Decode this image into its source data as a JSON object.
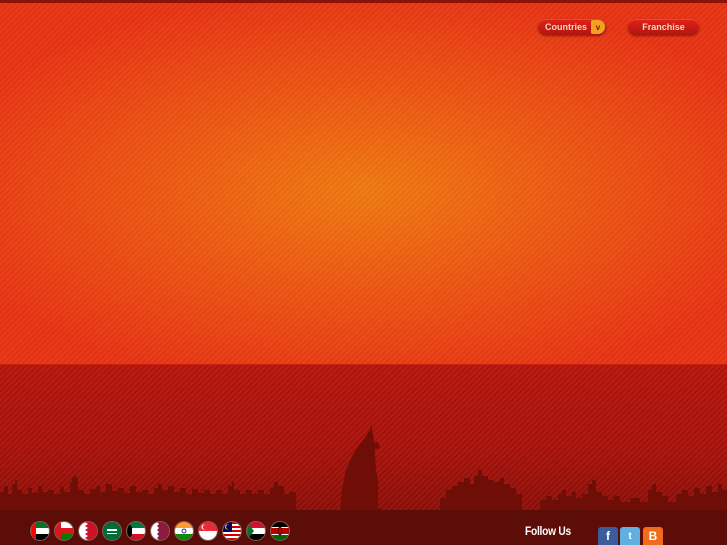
{
  "header": {
    "countries_label": "Countries",
    "countries_arrow": "v",
    "franchise_label": "Franchise"
  },
  "footer": {
    "follow_label": "Follow Us",
    "flags": [
      {
        "name": "uae",
        "colors": [
          "#00732f",
          "#ffffff",
          "#000000",
          "#ff0000"
        ]
      },
      {
        "name": "oman",
        "colors": [
          "#ffffff",
          "#db161b",
          "#008000"
        ]
      },
      {
        "name": "bahrain",
        "colors": [
          "#ce1126",
          "#ffffff"
        ]
      },
      {
        "name": "saudi-arabia",
        "colors": [
          "#006c35",
          "#ffffff"
        ]
      },
      {
        "name": "kuwait",
        "colors": [
          "#007a3d",
          "#ffffff",
          "#ce1126",
          "#000000"
        ]
      },
      {
        "name": "qatar",
        "colors": [
          "#8d1b3d",
          "#ffffff"
        ]
      },
      {
        "name": "india",
        "colors": [
          "#ff9933",
          "#ffffff",
          "#138808"
        ]
      },
      {
        "name": "singapore",
        "colors": [
          "#ed2939",
          "#ffffff"
        ]
      },
      {
        "name": "malaysia",
        "colors": [
          "#cc0001",
          "#ffffff",
          "#010066",
          "#ffcc00"
        ]
      },
      {
        "name": "sudan",
        "colors": [
          "#d21034",
          "#ffffff",
          "#000000",
          "#007229"
        ]
      },
      {
        "name": "kenya",
        "colors": [
          "#000000",
          "#bb0000",
          "#006600",
          "#ffffff"
        ]
      }
    ],
    "social": [
      {
        "name": "facebook",
        "glyph": "f",
        "color": "#3b5b9a"
      },
      {
        "name": "twitter",
        "glyph": "t",
        "color": "#5fb0e0"
      },
      {
        "name": "blogger",
        "glyph": "B",
        "color": "#f26b1a"
      }
    ]
  }
}
